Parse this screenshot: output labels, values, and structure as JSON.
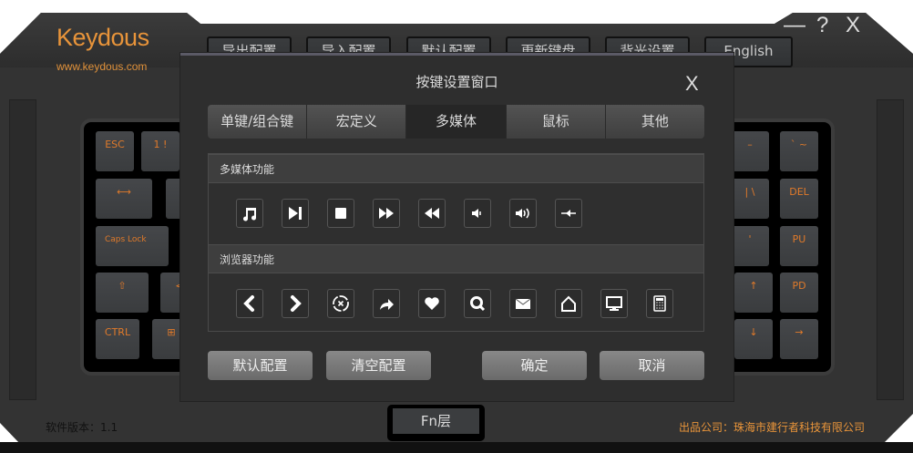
{
  "app": {
    "logo": "Keydous",
    "url": "www.keydous.com",
    "minimize": "—",
    "help": "?",
    "close": "X"
  },
  "toolbar": [
    "导出配置",
    "导入配置",
    "默认配置",
    "更新键盘",
    "背光设置",
    "English"
  ],
  "keys_left": [
    "ESC",
    "1 !",
    "⟷",
    "(",
    "Caps Lock",
    "⇧",
    "<",
    "CTRL",
    "⊞"
  ],
  "keys_right": [
    "–",
    "` ~",
    "| \\",
    "DEL",
    "'",
    "PU",
    "↑",
    "PD",
    "↓",
    "→"
  ],
  "dialog": {
    "title": "按键设置窗口",
    "close": "X",
    "tabs": [
      "单键/组合键",
      "宏定义",
      "多媒体",
      "鼠标",
      "其他"
    ],
    "selected_tab": "多媒体",
    "multimedia_title": "多媒体功能",
    "multimedia_icons": [
      "music-icon",
      "play-next-icon",
      "stop-icon",
      "fast-forward-icon",
      "rewind-icon",
      "volume-down-icon",
      "volume-up-icon",
      "mute-icon"
    ],
    "browser_title": "浏览器功能",
    "browser_icons": [
      "back-icon",
      "forward-icon",
      "stop-page-icon",
      "refresh-icon",
      "favorites-icon",
      "search-icon",
      "mail-icon",
      "home-icon",
      "my-computer-icon",
      "calculator-icon"
    ],
    "buttons": {
      "default": "默认配置",
      "clear": "清空配置",
      "ok": "确定",
      "cancel": "取消"
    }
  },
  "fn_layer": "Fn层",
  "footer": {
    "version": "软件版本：1.1",
    "company": "出品公司：珠海市建行者科技有限公司"
  }
}
